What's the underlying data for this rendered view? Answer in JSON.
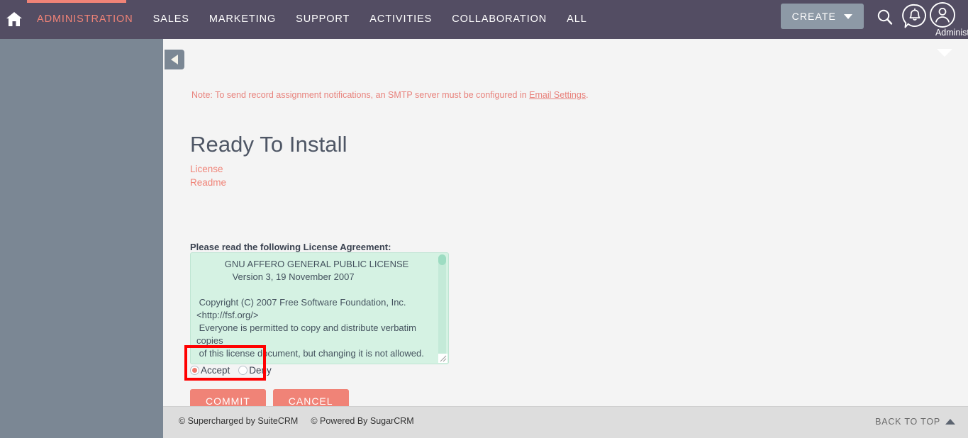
{
  "topnav": {
    "home_icon": "home-icon",
    "links": [
      {
        "label": "ADMINISTRATION",
        "active": true
      },
      {
        "label": "SALES",
        "active": false
      },
      {
        "label": "MARKETING",
        "active": false
      },
      {
        "label": "SUPPORT",
        "active": false
      },
      {
        "label": "ACTIVITIES",
        "active": false
      },
      {
        "label": "COLLABORATION",
        "active": false
      },
      {
        "label": "ALL",
        "active": false
      }
    ],
    "create_label": "CREATE",
    "search_icon": "search-icon",
    "notification_icon": "notification-bell-icon",
    "user_icon": "user-avatar-icon",
    "user_name": "Administr",
    "accent_color": "#f08377",
    "bar_color": "#534d63"
  },
  "sidebar": {
    "collapse_icon": "collapse-left-triangle-icon",
    "background_color": "#7b8794"
  },
  "main": {
    "collapse_chevron_icon": "chevron-down-icon",
    "note_prefix": "Note: To send record assignment notifications, an SMTP server must be configured in ",
    "note_link": "Email Settings",
    "note_suffix": ".",
    "title": "Ready To Install",
    "doc_links": [
      {
        "label": "License"
      },
      {
        "label": "Readme"
      }
    ],
    "license_label": "Please read the following License Agreement:",
    "license_text": "           GNU AFFERO GENERAL PUBLIC LICENSE\n              Version 3, 19 November 2007\n\n Copyright (C) 2007 Free Software Foundation, Inc.\n<http://fsf.org/>\n Everyone is permitted to copy and distribute verbatim\ncopies\n of this license document, but changing it is not allowed.",
    "radios": [
      {
        "label": "Accept",
        "checked": true
      },
      {
        "label": "Deny",
        "checked": false
      }
    ],
    "commit_label": "COMMIT",
    "cancel_label": "CANCEL",
    "highlight_color": "#ff0000",
    "button_color": "#f08377",
    "license_box_color": "#d5f2e3"
  },
  "footer": {
    "items": [
      {
        "label": "© Supercharged by SuiteCRM"
      },
      {
        "label": "© Powered By SugarCRM"
      }
    ],
    "back_to_top_label": "BACK TO TOP",
    "back_to_top_icon": "triangle-up-icon"
  }
}
